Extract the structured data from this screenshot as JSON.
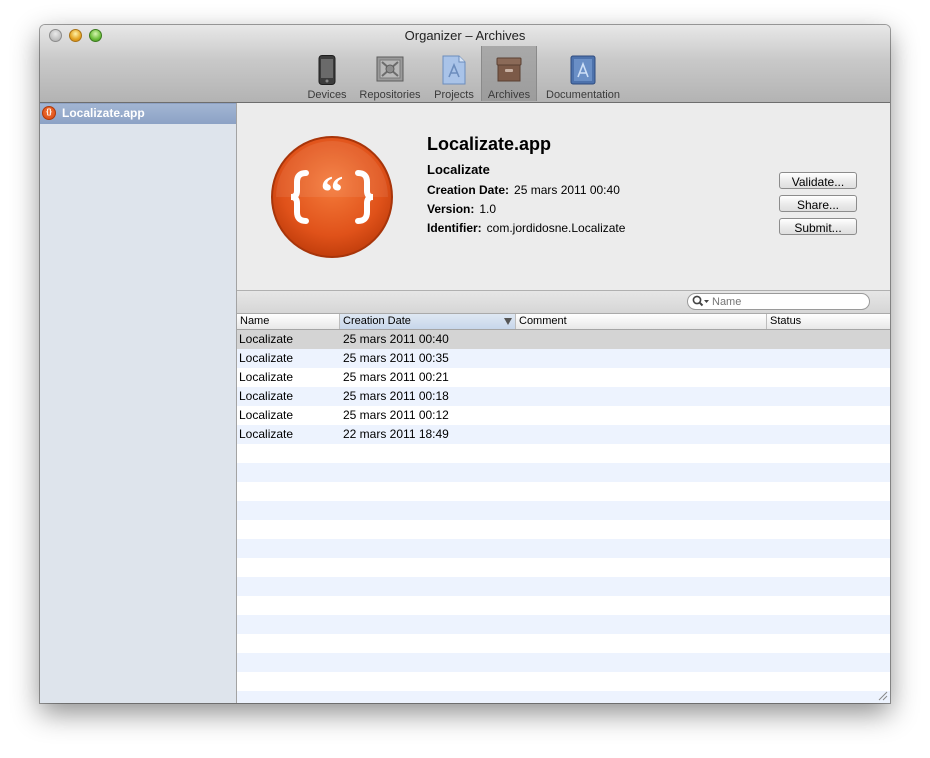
{
  "window": {
    "title": "Organizer – Archives"
  },
  "toolbar": {
    "items": [
      {
        "label": "Devices",
        "icon": "iphone-icon"
      },
      {
        "label": "Repositories",
        "icon": "repository-icon"
      },
      {
        "label": "Projects",
        "icon": "project-icon"
      },
      {
        "label": "Archives",
        "icon": "archive-box-icon",
        "active": true
      },
      {
        "label": "Documentation",
        "icon": "documentation-icon"
      }
    ]
  },
  "sidebar": {
    "items": [
      {
        "label": "Localizate.app",
        "selected": true
      }
    ]
  },
  "detail": {
    "app_name": "Localizate.app",
    "subtitle": "Localizate",
    "creation_date_label": "Creation Date:",
    "creation_date": "25 mars 2011 00:40",
    "version_label": "Version:",
    "version": "1.0",
    "identifier_label": "Identifier:",
    "identifier": "com.jordidosne.Localizate",
    "buttons": {
      "validate": "Validate...",
      "share": "Share...",
      "submit": "Submit..."
    }
  },
  "search": {
    "placeholder": "Name"
  },
  "table": {
    "columns": [
      "Name",
      "Creation Date",
      "Comment",
      "Status"
    ],
    "sorted_column": "Creation Date",
    "rows": [
      {
        "name": "Localizate",
        "date": "25 mars 2011 00:40",
        "comment": "",
        "status": ""
      },
      {
        "name": "Localizate",
        "date": "25 mars 2011 00:35",
        "comment": "",
        "status": ""
      },
      {
        "name": "Localizate",
        "date": "25 mars 2011 00:21",
        "comment": "",
        "status": ""
      },
      {
        "name": "Localizate",
        "date": "25 mars 2011 00:18",
        "comment": "",
        "status": ""
      },
      {
        "name": "Localizate",
        "date": "25 mars 2011 00:12",
        "comment": "",
        "status": ""
      },
      {
        "name": "Localizate",
        "date": "22 mars 2011 18:49",
        "comment": "",
        "status": ""
      }
    ]
  },
  "colors": {
    "accent_orange": "#e2561b",
    "sidebar_bg": "#dee4ec",
    "selection_blue": "#8ca2c5",
    "stripe": "#edf3fe"
  }
}
